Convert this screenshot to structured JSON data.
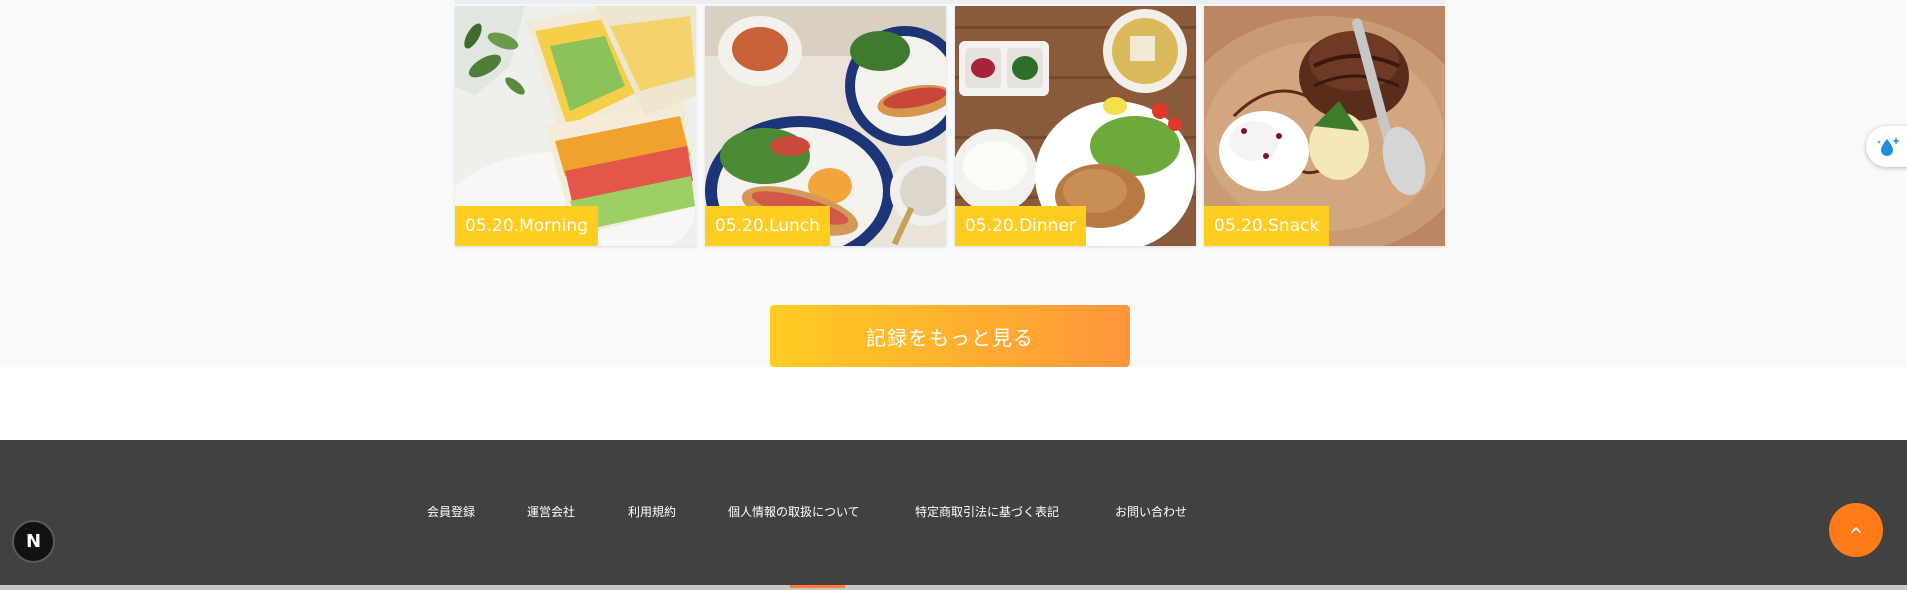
{
  "records": {
    "cards": [
      {
        "label": "05.20.Morning",
        "image": "sandwich-photo"
      },
      {
        "label": "05.20.Lunch",
        "image": "hotdog-salad-photo"
      },
      {
        "label": "05.20.Dinner",
        "image": "grilled-chicken-set-photo"
      },
      {
        "label": "05.20.Snack",
        "image": "chocolate-cake-photo"
      }
    ],
    "more_button_label": "記録をもっと見る"
  },
  "footer": {
    "links": [
      "会員登録",
      "運営会社",
      "利用規約",
      "個人情報の取扱について",
      "特定商取引法に基づく表記",
      "お問い合わせ"
    ]
  },
  "widgets": {
    "scroll_top_icon": "chevron-up-icon",
    "badge_letter": "N",
    "side_widget_icon": "water-drop-sparkle-icon"
  },
  "colors": {
    "label_bg": "#ffcc21",
    "button_gradient_start": "#ffcc21",
    "button_gradient_end": "#ff963c",
    "footer_bg": "#414141",
    "scroll_top_bg": "#ff7a18"
  }
}
